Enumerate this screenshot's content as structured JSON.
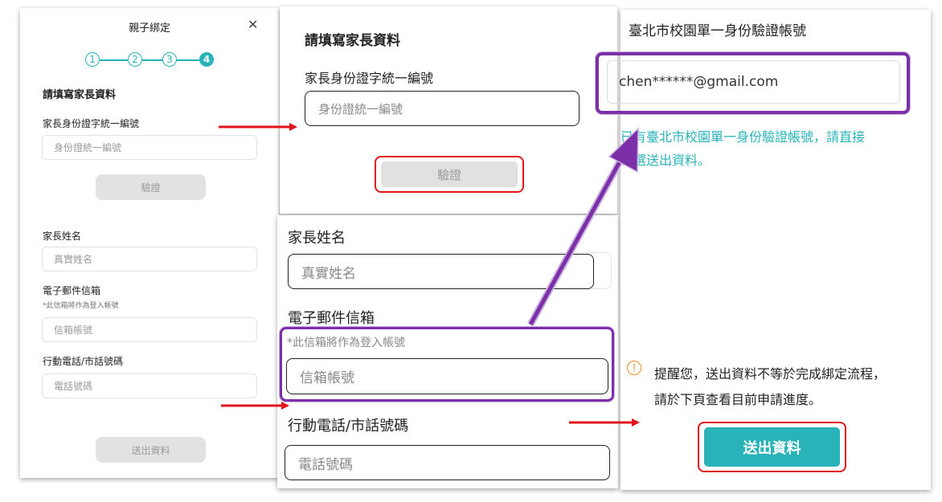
{
  "left_panel": {
    "title": "親子綁定",
    "close_symbol": "✕",
    "steps": [
      "1",
      "2",
      "3",
      "4"
    ],
    "section_title": "請填寫家長資料",
    "id_label": "家長身份證字統一編號",
    "id_placeholder": "身份證統一編號",
    "verify_label": "驗證",
    "name_label": "家長姓名",
    "name_placeholder": "真實姓名",
    "email_label": "電子郵件信箱",
    "email_note": "*此信箱將作為登入帳號",
    "email_placeholder": "信箱帳號",
    "phone_label": "行動電話/市話號碼",
    "phone_placeholder": "電話號碼",
    "submit_label": "送出資料"
  },
  "zoom_top": {
    "section_title": "請填寫家長資料",
    "id_label": "家長身份證字統一編號",
    "id_placeholder": "身份證統一編號",
    "verify_label": "驗證"
  },
  "zoom_mid": {
    "name_label": "家長姓名",
    "name_placeholder": "真實姓名",
    "email_label": "電子郵件信箱",
    "email_note": "*此信箱將作為登入帳號",
    "email_placeholder": "信箱帳號",
    "phone_label": "行動電話/市話號碼",
    "phone_placeholder": "電話號碼"
  },
  "zoom_right": {
    "account_label": "臺北市校園單一身份驗證帳號",
    "account_value": "chen******@gmail.com",
    "hint_line1": "已有臺北市校園單一身份驗證帳號，請直接",
    "hint_line2": "點選送出資料。",
    "reminder_icon": "!",
    "reminder_line1": "提醒您，送出資料不等於完成綁定流程，",
    "reminder_line2": "請於下頁查看目前申請進度。",
    "submit_label": "送出資料"
  },
  "colors": {
    "teal": "#29b3b8",
    "red": "#e0151b",
    "purple": "#7b2fa8",
    "orange": "#f08c1e"
  },
  "icons": [
    "close-icon",
    "warning-icon",
    "arrow-icon"
  ]
}
